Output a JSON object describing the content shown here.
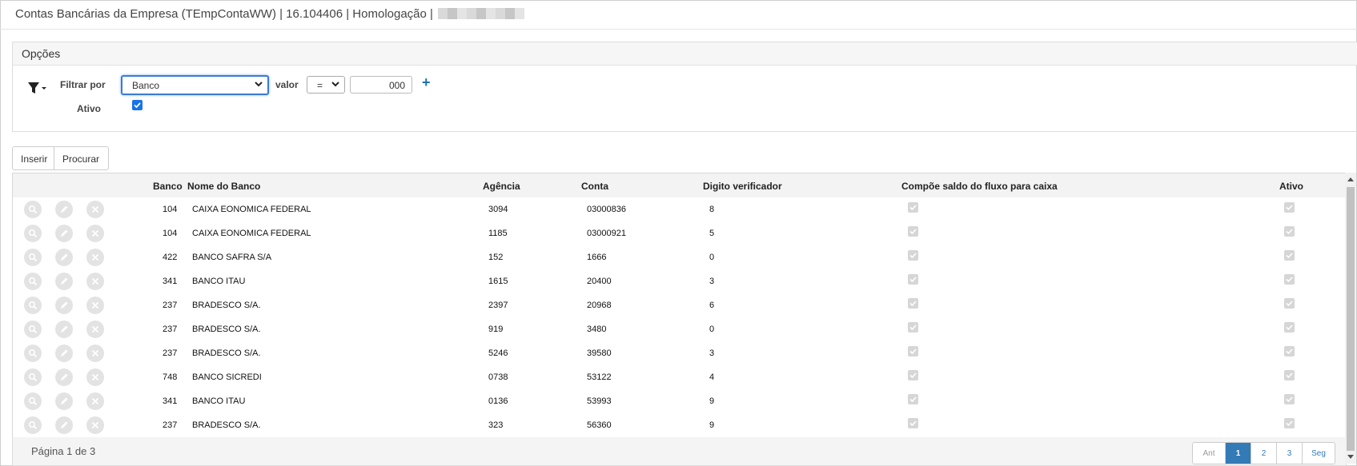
{
  "window": {
    "title": "Contas Bancárias da Empresa (TEmpContaWW) | 16.104406 | Homologação |"
  },
  "options": {
    "panel_title": "Opções",
    "filter_label": "Filtrar por",
    "filter_field": "Banco",
    "value_label": "valor",
    "operator": "=",
    "value": "000",
    "active_label": "Ativo",
    "active_checked": true
  },
  "toolbar": {
    "insert_label": "Inserir",
    "search_label": "Procurar"
  },
  "grid": {
    "columns": {
      "banco": "Banco",
      "nome": "Nome do Banco",
      "agencia": "Agência",
      "conta": "Conta",
      "digito": "Digito verificador",
      "compoe": "Compõe saldo do fluxo para caixa",
      "ativo": "Ativo"
    },
    "rows": [
      {
        "banco": "104",
        "nome": "CAIXA EONOMICA FEDERAL",
        "agencia": "3094",
        "conta": "03000836",
        "digito": "8"
      },
      {
        "banco": "104",
        "nome": "CAIXA EONOMICA FEDERAL",
        "agencia": "1185",
        "conta": "03000921",
        "digito": "5"
      },
      {
        "banco": "422",
        "nome": "BANCO SAFRA S/A",
        "agencia": "152",
        "conta": "1666",
        "digito": "0"
      },
      {
        "banco": "341",
        "nome": "BANCO ITAU",
        "agencia": "1615",
        "conta": "20400",
        "digito": "3"
      },
      {
        "banco": "237",
        "nome": "BRADESCO S/A.",
        "agencia": "2397",
        "conta": "20968",
        "digito": "6"
      },
      {
        "banco": "237",
        "nome": "BRADESCO S/A.",
        "agencia": "919",
        "conta": "3480",
        "digito": "0"
      },
      {
        "banco": "237",
        "nome": "BRADESCO S/A.",
        "agencia": "5246",
        "conta": "39580",
        "digito": "3"
      },
      {
        "banco": "748",
        "nome": "BANCO SICREDI",
        "agencia": "0738",
        "conta": "53122",
        "digito": "4"
      },
      {
        "banco": "341",
        "nome": "BANCO ITAU",
        "agencia": "0136",
        "conta": "53993",
        "digito": "9"
      },
      {
        "banco": "237",
        "nome": "BRADESCO S/A.",
        "agencia": "323",
        "conta": "56360",
        "digito": "9"
      }
    ]
  },
  "pagination": {
    "info": "Página 1 de 3",
    "prev_label": "Ant",
    "pages": [
      "1",
      "2",
      "3"
    ],
    "current_page": "1",
    "next_label": "Seg"
  },
  "icons": {
    "filter": "filter-icon",
    "view": "search-icon",
    "edit": "pencil-icon",
    "delete": "close-icon",
    "add": "plus-icon"
  },
  "colors": {
    "accent": "#337ab7",
    "checkbox": "#1a73e8",
    "add_icon": "#1f6fb5"
  }
}
